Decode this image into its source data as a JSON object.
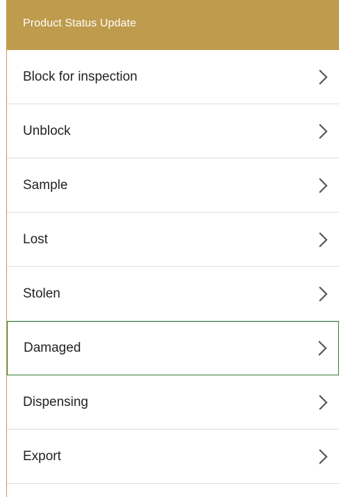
{
  "header": {
    "title": "Product Status Update"
  },
  "colors": {
    "header_background": "#bf9b4d",
    "selected_border": "#2e7d32"
  },
  "menu": {
    "items": [
      {
        "label": "Block for inspection",
        "icon": "chevron-right-icon"
      },
      {
        "label": "Unblock",
        "icon": "chevron-right-icon"
      },
      {
        "label": "Sample",
        "icon": "chevron-right-icon"
      },
      {
        "label": "Lost",
        "icon": "chevron-right-icon"
      },
      {
        "label": "Stolen",
        "icon": "chevron-right-icon"
      },
      {
        "label": "Damaged",
        "icon": "chevron-right-icon",
        "selected": true
      },
      {
        "label": "Dispensing",
        "icon": "chevron-right-icon"
      },
      {
        "label": "Export",
        "icon": "chevron-right-icon"
      }
    ]
  }
}
